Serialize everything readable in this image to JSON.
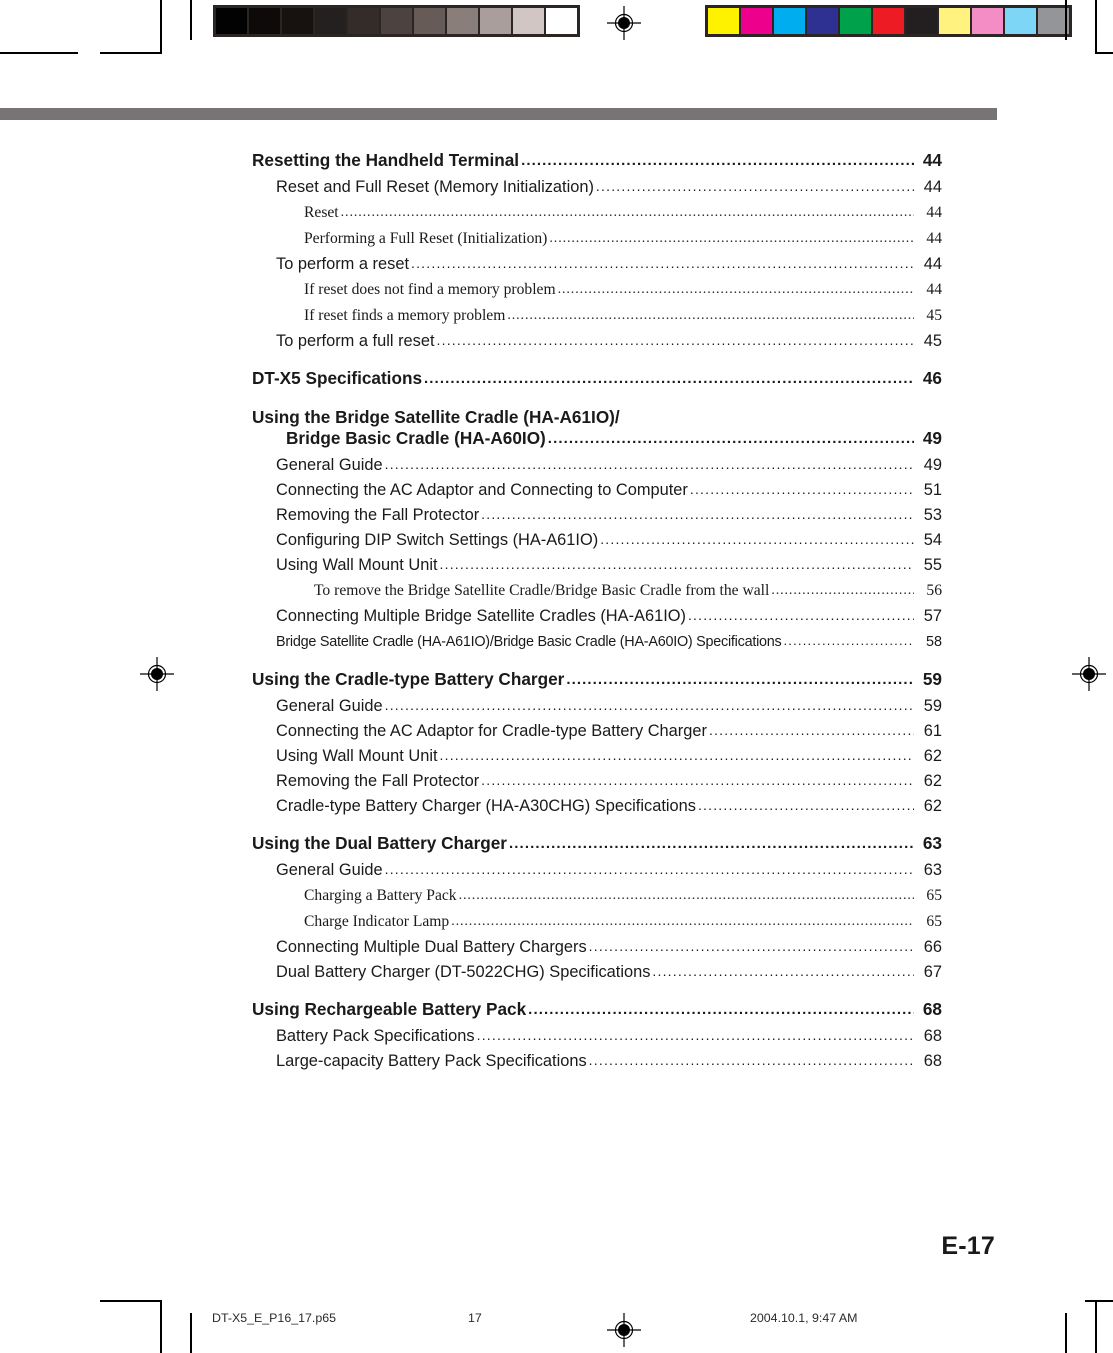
{
  "document": {
    "folio": "E-17",
    "header_rule_color": "#787476"
  },
  "toc": {
    "entries": [
      {
        "level": 1,
        "title": "Resetting the Handheld Terminal",
        "page": "44"
      },
      {
        "level": 2,
        "title": "Reset and Full Reset (Memory Initialization)",
        "page": "44"
      },
      {
        "level": 3,
        "title": "Reset",
        "page": "44"
      },
      {
        "level": 3,
        "title": "Performing a Full Reset (Initialization)",
        "page": "44"
      },
      {
        "level": 2,
        "title": "To perform a reset",
        "page": "44"
      },
      {
        "level": 3,
        "title": "If reset does not find a memory problem",
        "page": "44"
      },
      {
        "level": 3,
        "title": "If reset finds a memory problem",
        "page": "45"
      },
      {
        "level": 2,
        "title": "To perform a full reset",
        "page": "45"
      },
      {
        "level": 1,
        "title": "DT-X5 Specifications",
        "page": "46"
      },
      {
        "level": 1,
        "title": "Using the Bridge Satellite Cradle (HA-A61IO)/",
        "wrap": "Bridge Basic Cradle (HA-A60IO)",
        "page": "49"
      },
      {
        "level": 2,
        "title": "General Guide",
        "page": "49"
      },
      {
        "level": 2,
        "title": "Connecting the AC Adaptor and Connecting to Computer",
        "page": "51"
      },
      {
        "level": 2,
        "title": "Removing the Fall Protector",
        "page": "53"
      },
      {
        "level": 2,
        "title": "Configuring DIP Switch Settings (HA-A61IO)",
        "page": "54"
      },
      {
        "level": 2,
        "title": "Using Wall Mount Unit",
        "page": "55"
      },
      {
        "level": 3,
        "title": "To remove the Bridge Satellite Cradle/Bridge Basic Cradle from the wall",
        "page": "56"
      },
      {
        "level": 2,
        "title": "Connecting Multiple Bridge Satellite Cradles (HA-A61IO)",
        "page": "57"
      },
      {
        "level": 2,
        "condensed": true,
        "title": "Bridge Satellite Cradle (HA-A61IO)/Bridge Basic Cradle (HA-A60IO) Specifications",
        "page": "58"
      },
      {
        "level": 1,
        "title": "Using the Cradle-type Battery Charger",
        "page": "59"
      },
      {
        "level": 2,
        "title": "General Guide",
        "page": "59"
      },
      {
        "level": 2,
        "title": "Connecting the AC Adaptor for Cradle-type Battery Charger",
        "page": "61"
      },
      {
        "level": 2,
        "title": "Using Wall Mount Unit",
        "page": "62"
      },
      {
        "level": 2,
        "title": "Removing the Fall Protector",
        "page": "62"
      },
      {
        "level": 2,
        "title": "Cradle-type Battery Charger (HA-A30CHG) Specifications",
        "page": "62"
      },
      {
        "level": 1,
        "title": "Using the Dual Battery Charger",
        "page": "63"
      },
      {
        "level": 2,
        "title": "General Guide",
        "page": "63"
      },
      {
        "level": 3,
        "title": "Charging a Battery Pack",
        "page": "65"
      },
      {
        "level": 3,
        "title": "Charge Indicator Lamp",
        "page": "65"
      },
      {
        "level": 2,
        "title": "Connecting Multiple Dual Battery Chargers",
        "page": "66"
      },
      {
        "level": 2,
        "title": "Dual Battery Charger (DT-5022CHG) Specifications",
        "page": "67"
      },
      {
        "level": 1,
        "title": "Using Rechargeable Battery Pack",
        "page": "68"
      },
      {
        "level": 2,
        "title": "Battery Pack Specifications",
        "page": "68"
      },
      {
        "level": 2,
        "title": "Large-capacity Battery Pack Specifications",
        "page": "68"
      }
    ]
  },
  "footer": {
    "file_name": "DT-X5_E_P16_17.p65",
    "page_number": "17",
    "timestamp": "2004.10.1, 9:47 AM"
  },
  "calibration": {
    "grayscale_swatches": [
      "#020202",
      "#0e0a09",
      "#171210",
      "#252020",
      "#332c29",
      "#4c423f",
      "#665b57",
      "#8a7e7a",
      "#a99e9b",
      "#d2c6c4",
      "#ffffff"
    ],
    "color_swatches": [
      "#fff200",
      "#ec008c",
      "#00aeef",
      "#2e3192",
      "#00a14b",
      "#ed1c24",
      "#231f20",
      "#fff27f",
      "#f48cc6",
      "#7ed6f7",
      "#939598"
    ],
    "strip_background": "#2b2523"
  }
}
